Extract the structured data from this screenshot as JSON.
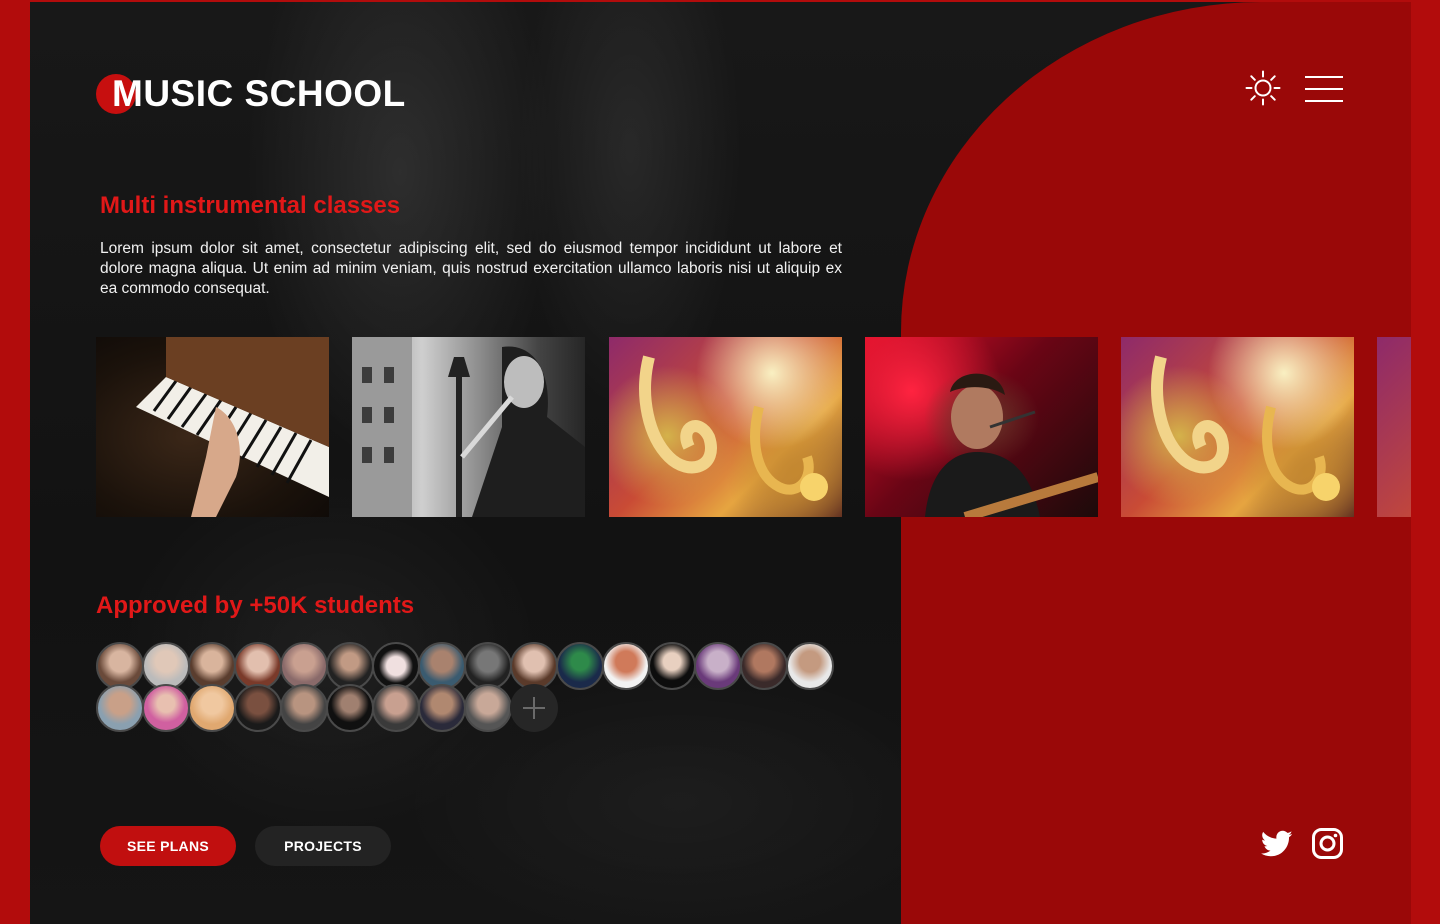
{
  "brand": {
    "logo_text": "MUSIC SCHOOL"
  },
  "header": {
    "icons": [
      "sun-icon",
      "hamburger-menu-icon"
    ]
  },
  "hero": {
    "title": "Multi instrumental classes",
    "description": "Lorem ipsum dolor sit amet, consectetur adipiscing elit, sed do eiusmod tempor incididunt ut labore et dolore magna aliqua. Ut enim ad minim veniam, quis nostrud exercitation ullamco laboris nisi ut aliquip ex ea commodo consequat."
  },
  "gallery": {
    "photos": [
      "piano-photo",
      "flute-street-photo",
      "saxophone-band-photo",
      "guitar-singer-photo",
      "saxophone-band-photo",
      "saxophone-band-photo"
    ]
  },
  "students": {
    "title": "Approved by +50K students",
    "avatar_count": 24,
    "add_icon": "plus-icon"
  },
  "actions": {
    "see_plans": "SEE PLANS",
    "projects": "PROJECTS"
  },
  "social": {
    "icons": [
      "twitter-icon",
      "instagram-icon"
    ]
  },
  "colors": {
    "accent": "#e11818",
    "button_primary": "#c10f0f",
    "panel_red": "#9a0808",
    "background": "#131313"
  }
}
